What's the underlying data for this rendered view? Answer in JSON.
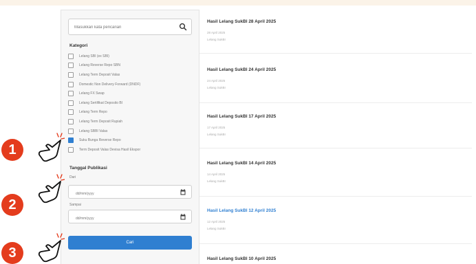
{
  "search": {
    "placeholder": "Masukkan kata pencarian"
  },
  "filters": {
    "category_title": "Kategori",
    "categories": [
      {
        "label": "Lelang SBI (ex SBI)",
        "checked": false
      },
      {
        "label": "Lelang Reverse Repo SBN",
        "checked": false
      },
      {
        "label": "Lelang Term Deposit Valas",
        "checked": false
      },
      {
        "label": "Domestic Non Delivery Forward (DNDF)",
        "checked": false
      },
      {
        "label": "Lelang FX Swap",
        "checked": false
      },
      {
        "label": "Lelang Sertifikat Deposito BI",
        "checked": false
      },
      {
        "label": "Lelang Term Repo",
        "checked": false
      },
      {
        "label": "Lelang Term Deposit Rupiah",
        "checked": false
      },
      {
        "label": "Lelang SBBI Valas",
        "checked": false
      },
      {
        "label": "Suku Bunga Reverse Repo",
        "checked": true
      },
      {
        "label": "Term Deposit Valas Devisa Hasil Ekspor",
        "checked": false
      }
    ],
    "pub_date_title": "Tanggal Publikasi",
    "from_label": "Dari",
    "to_label": "Sampai",
    "date_placeholder": "dd/mm/yyyy",
    "submit_label": "Cari"
  },
  "results": [
    {
      "title": "Hasil Lelang SukBI 28 April 2025",
      "date": "28 April 2025",
      "ref": "Lelang SukBI",
      "link": false
    },
    {
      "title": "Hasil Lelang SukBI 24 April 2025",
      "date": "24 April 2025",
      "ref": "Lelang SukBI",
      "link": false
    },
    {
      "title": "Hasil Lelang SukBI 17 April 2025",
      "date": "17 April 2025",
      "ref": "Lelang SukBI",
      "link": false
    },
    {
      "title": "Hasil Lelang SukBI 14 April 2025",
      "date": "14 April 2025",
      "ref": "Lelang SukBI",
      "link": false
    },
    {
      "title": "Hasil Lelang SukBI 12 April 2025",
      "date": "12 April 2025",
      "ref": "Lelang SukBI",
      "link": true
    },
    {
      "title": "Hasil Lelang SukBI 10 April 2025",
      "date": "",
      "ref": "",
      "link": false
    }
  ],
  "steps": [
    "1",
    "2",
    "3"
  ],
  "colors": {
    "accent": "#2f7fd1",
    "badge": "#e43c1d"
  }
}
